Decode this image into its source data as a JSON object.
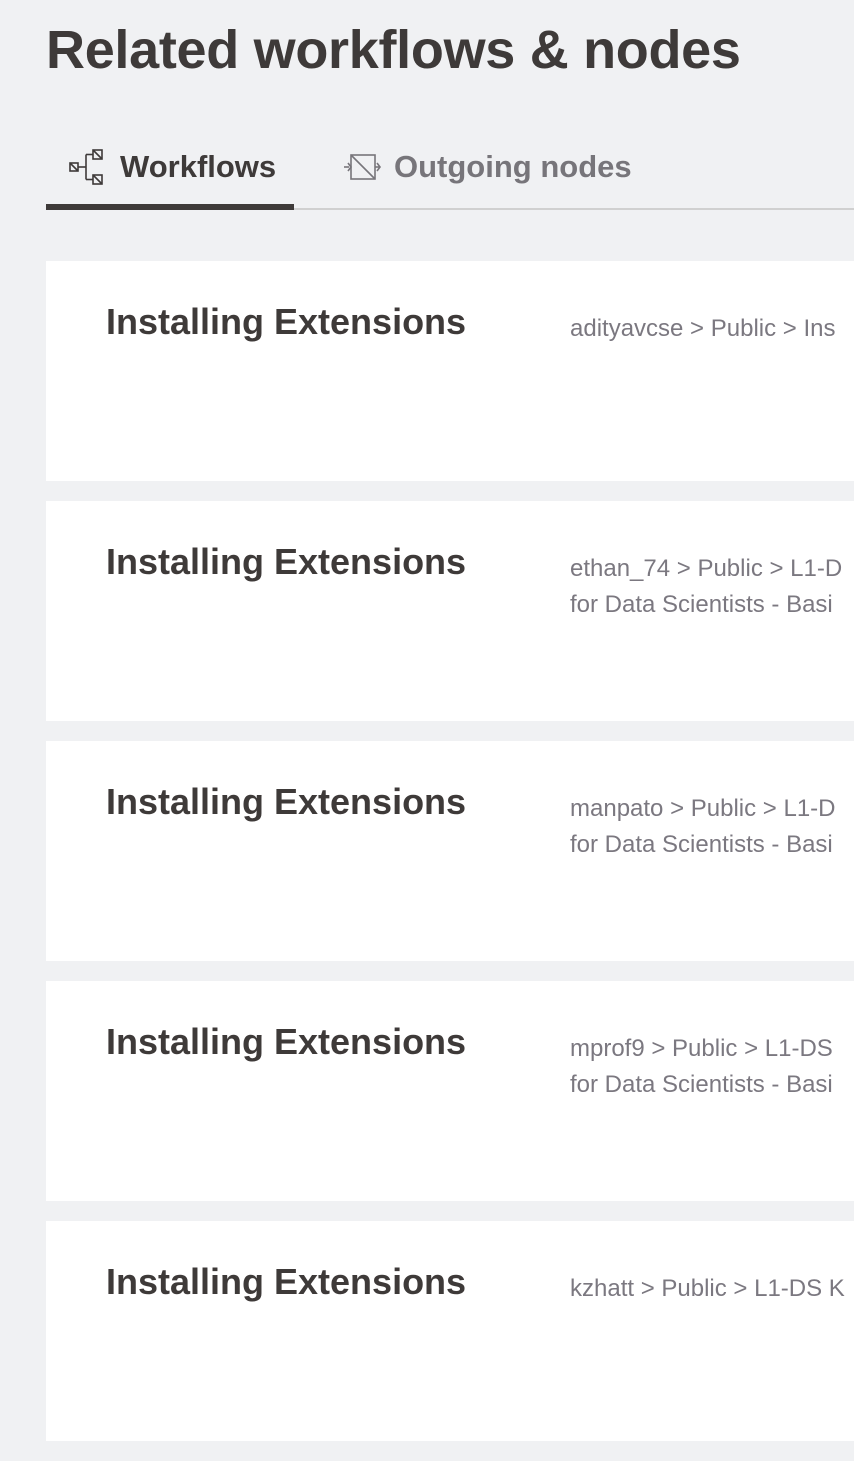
{
  "page": {
    "title": "Related workflows & nodes"
  },
  "tabs": [
    {
      "label": "Workflows",
      "icon": "workflow-icon",
      "active": true
    },
    {
      "label": "Outgoing nodes",
      "icon": "node-icon",
      "active": false
    }
  ],
  "workflows": [
    {
      "title": "Installing Extensions",
      "path": "adityavcse > Public > Ins"
    },
    {
      "title": "Installing Extensions",
      "path": "ethan_74 > Public > L1-D\nfor Data Scientists - Basi"
    },
    {
      "title": "Installing Extensions",
      "path": "manpato > Public > L1-D\nfor Data Scientists - Basi"
    },
    {
      "title": "Installing Extensions",
      "path": "mprof9 > Public > L1-DS \nfor Data Scientists - Basi"
    },
    {
      "title": "Installing Extensions",
      "path": "kzhatt > Public > L1-DS K"
    }
  ],
  "colors": {
    "background": "#f0f1f3",
    "text_dark": "#3e3a39",
    "text_muted": "#7b7880",
    "card": "#ffffff",
    "tab_border": "#d0d0d0"
  }
}
